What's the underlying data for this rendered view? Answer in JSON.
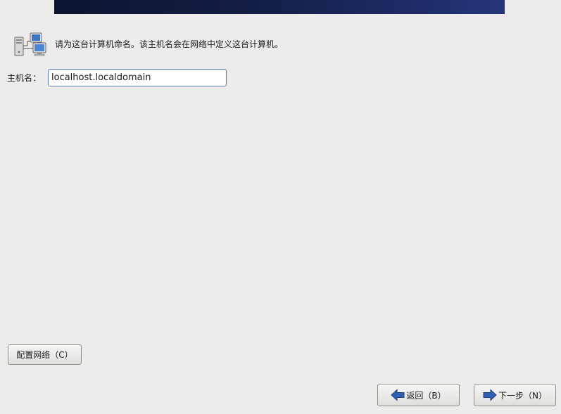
{
  "intro": {
    "icon": "network-computers-icon",
    "text": "请为这台计算机命名。该主机名会在网络中定义这台计算机。"
  },
  "hostname": {
    "label": "主机名：",
    "value": "localhost.localdomain"
  },
  "buttons": {
    "configure_network": "配置网络（C）",
    "back": "返回（B）",
    "next": "下一步（N）"
  },
  "colors": {
    "banner": "#141d45",
    "arrow_blue": "#2f5fb3",
    "background": "#edeceb"
  }
}
